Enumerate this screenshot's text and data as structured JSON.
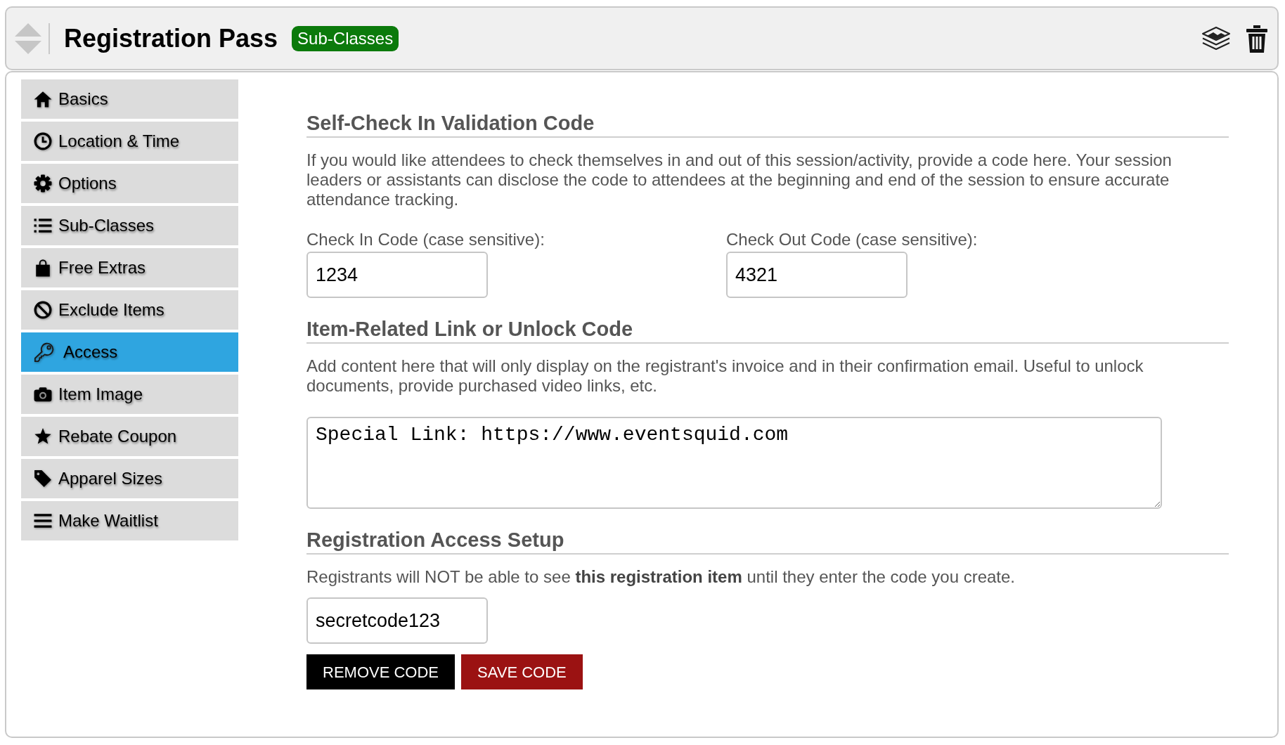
{
  "header": {
    "title": "Registration Pass",
    "badge": "Sub-Classes"
  },
  "sidebar": {
    "items": [
      {
        "label": "Basics",
        "selected": false
      },
      {
        "label": "Location & Time",
        "selected": false
      },
      {
        "label": "Options",
        "selected": false
      },
      {
        "label": "Sub-Classes",
        "selected": false
      },
      {
        "label": "Free Extras",
        "selected": false
      },
      {
        "label": "Exclude Items",
        "selected": false
      },
      {
        "label": "Access",
        "selected": true
      },
      {
        "label": "Item Image",
        "selected": false
      },
      {
        "label": "Rebate Coupon",
        "selected": false
      },
      {
        "label": "Apparel Sizes",
        "selected": false
      },
      {
        "label": "Make Waitlist",
        "selected": false
      }
    ]
  },
  "self_check": {
    "heading": "Self-Check In Validation Code",
    "description": "If you would like attendees to check themselves in and out of this session/activity, provide a code here. Your session leaders or assistants can disclose the code to attendees at the beginning and end of the session to ensure accurate attendance tracking.",
    "fields": [
      {
        "label": "Check In Code (case sensitive):",
        "value": "1234"
      },
      {
        "label": "Check Out Code (case sensitive):",
        "value": "4321"
      }
    ]
  },
  "item_link": {
    "heading": "Item-Related Link or Unlock Code",
    "description": "Add content here that will only display on the registrant's invoice and in their confirmation email. Useful to unlock documents, provide purchased video links, etc.",
    "value": "Special Link: https://www.eventsquid.com"
  },
  "access_setup": {
    "heading": "Registration Access Setup",
    "description": "Registrants will NOT be able to see **this registration item** until they enter the code you create.",
    "value": "secretcode123",
    "buttons": [
      {
        "label": "REMOVE CODE",
        "kind": "remove"
      },
      {
        "label": "SAVE CODE",
        "kind": "save"
      }
    ]
  }
}
